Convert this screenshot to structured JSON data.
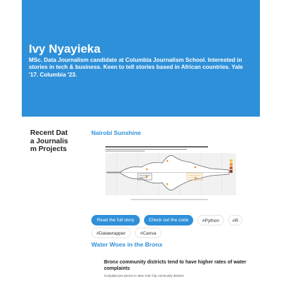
{
  "hero": {
    "name": "Ivy Nyayieka",
    "bio": "MSc. Data Journalism candidate at Columbia Journalism School. Interested in stories in tech & business. Keen to tell stories based in African countries. Yale '17. Columbia '23."
  },
  "sidebar": {
    "title": "Recent Data Journalism Projects"
  },
  "projects": [
    {
      "title": "Nairobi Sunshine",
      "buttons": {
        "read": "Read the full story",
        "code": "Check out the code"
      },
      "tags": [
        "#Python",
        "#R",
        "#Datawrapper",
        "#Canva"
      ]
    },
    {
      "title": "Water Woes in the Bronx",
      "preview_title": "Bronx community districts tend to have higher rates of water complaints",
      "preview_subtitle": "Complaint per person in New York City community districts"
    }
  ],
  "colors": {
    "accent": "#2e90d9",
    "hero_text": "#ffffff"
  }
}
